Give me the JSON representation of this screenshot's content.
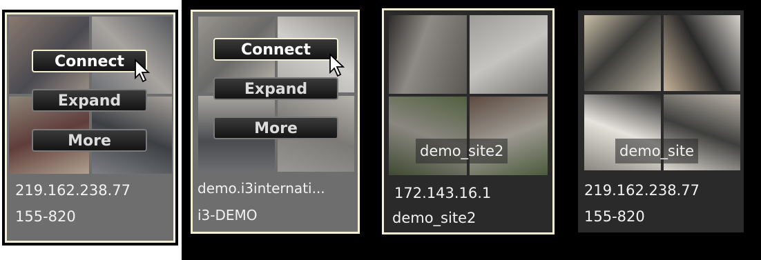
{
  "cards": [
    {
      "ip": "219.162.238.77",
      "name": "155-820",
      "buttons": {
        "connect": "Connect",
        "expand": "Expand",
        "more": "More"
      }
    },
    {
      "ip": "demo.i3internati...",
      "name": "i3-DEMO",
      "buttons": {
        "connect": "Connect",
        "expand": "Expand",
        "more": "More"
      }
    },
    {
      "ip": "172.143.16.1",
      "name": "demo_site2",
      "label": "demo_site2"
    },
    {
      "ip": "219.162.238.77",
      "name": "155-820",
      "label": "demo_site"
    }
  ],
  "colors": {
    "frame": "#f3f0d4",
    "panel": "#6e6e6e",
    "dark_panel": "#2a2a2a"
  },
  "icons": {
    "pointer": "mouse-cursor-icon"
  }
}
